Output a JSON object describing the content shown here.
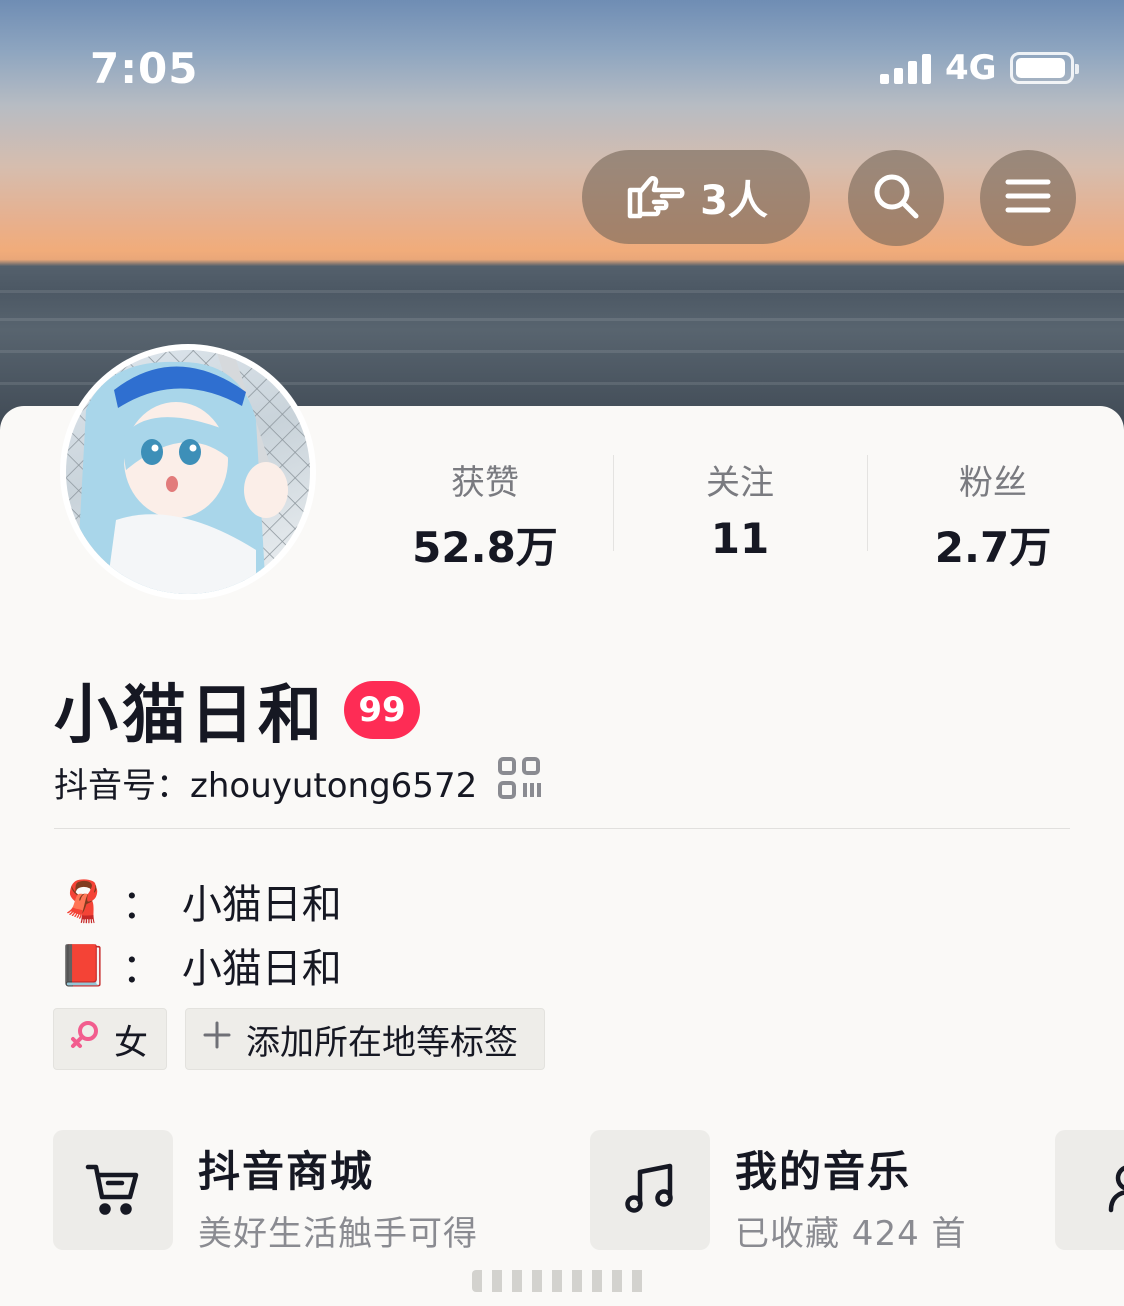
{
  "status_bar": {
    "time": "7:05",
    "network": "4G",
    "battery_level": 0.95
  },
  "header": {
    "visitors_label": "3人",
    "icons": {
      "visitors": "pointing-hand-icon",
      "search": "search-icon",
      "menu": "menu-icon"
    }
  },
  "profile": {
    "name": "小猫日和",
    "level_badge": "99",
    "douyin_id": "抖音号：zhouyutong6572",
    "stats": [
      {
        "label": "获赞",
        "value": "52.8万"
      },
      {
        "label": "关注",
        "value": "11"
      },
      {
        "label": "粉丝",
        "value": "2.7万"
      }
    ],
    "bio": [
      {
        "emoji": "🧣",
        "sep": "：",
        "text": "小猫日和"
      },
      {
        "emoji": "📕",
        "sep": "：",
        "text": "小猫日和"
      }
    ],
    "tags": {
      "gender": "女",
      "add_tag": "添加所在地等标签"
    }
  },
  "features": [
    {
      "title": "抖音商城",
      "subtitle": "美好生活触手可得",
      "icon": "cart-icon"
    },
    {
      "title": "我的音乐",
      "subtitle": "已收藏 424 首",
      "icon": "music-note-icon"
    },
    {
      "title": "",
      "subtitle": "",
      "icon": "friends-icon"
    }
  ],
  "colors": {
    "accent": "#fe2c55",
    "text": "#161823",
    "muted": "#8a8b91",
    "background": "#faf9f7"
  }
}
